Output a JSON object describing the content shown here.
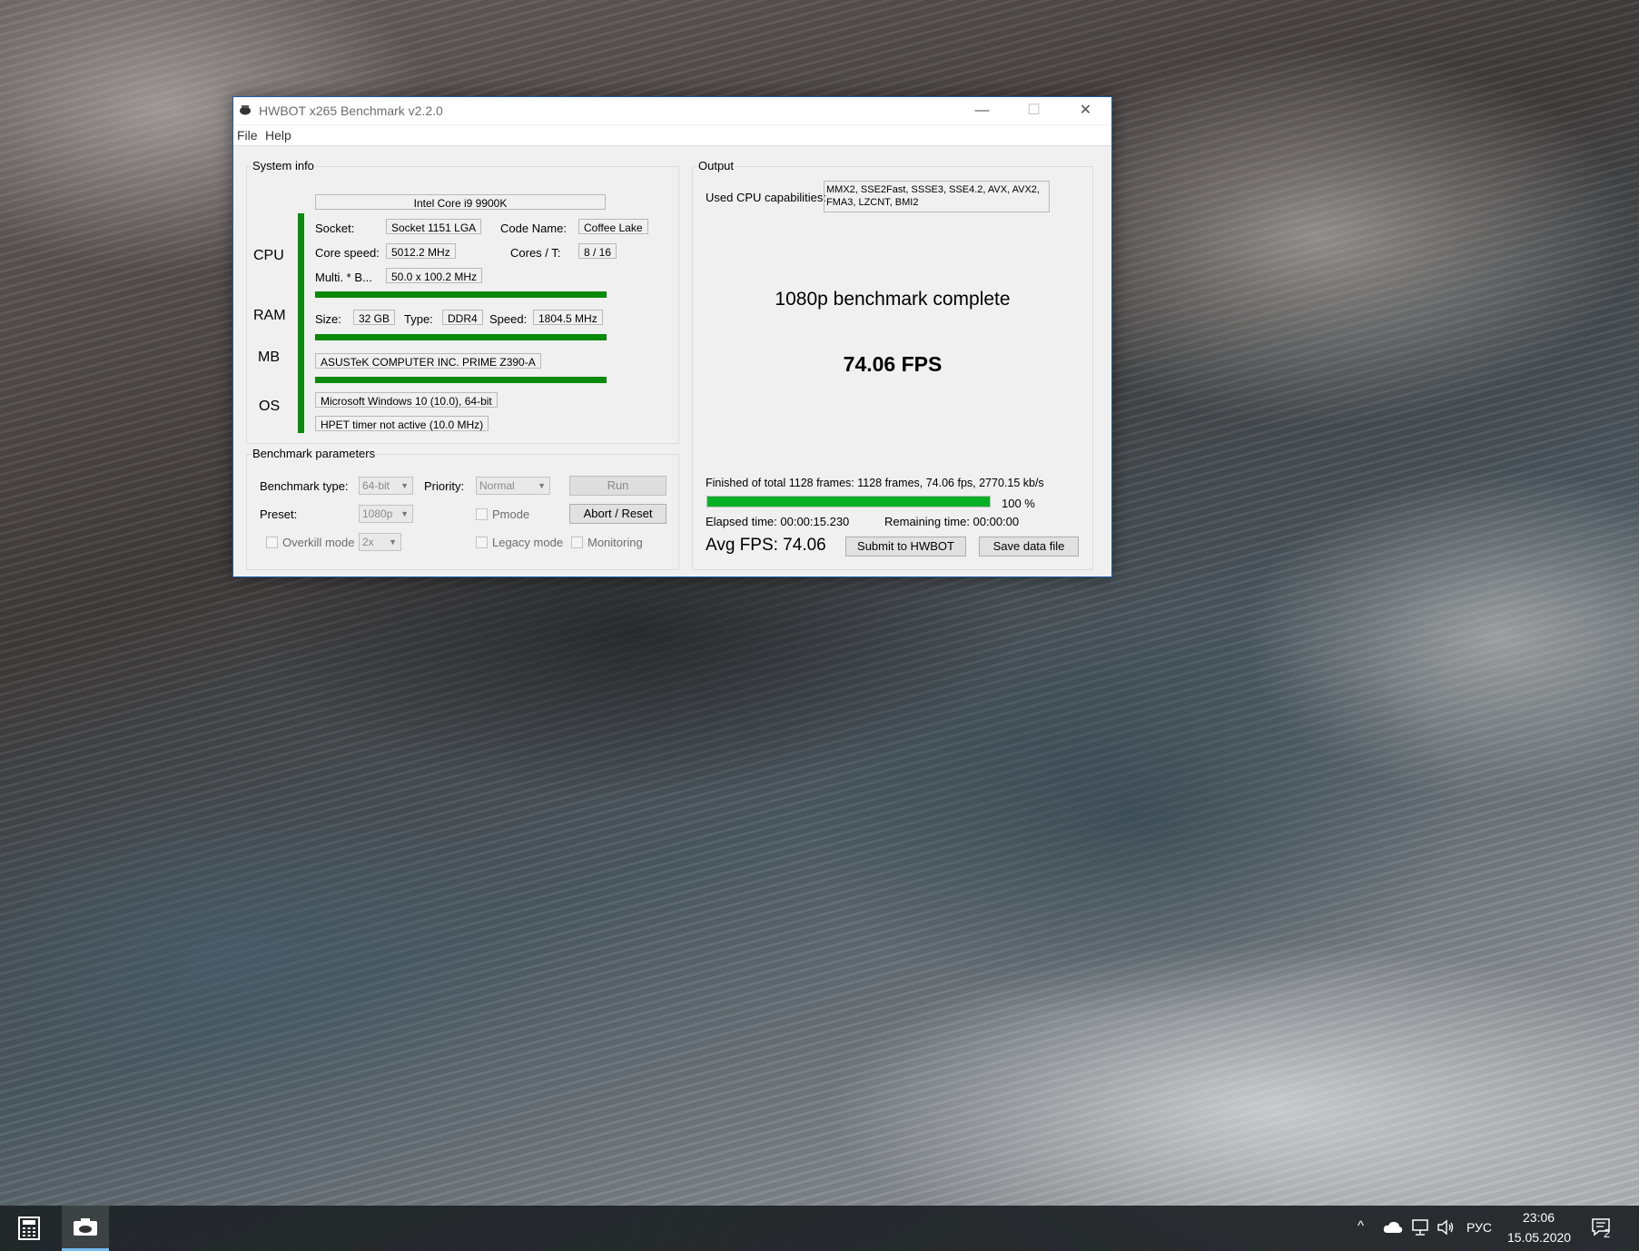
{
  "window": {
    "title": "HWBOT x265 Benchmark v2.2.0",
    "minimize": "—",
    "maximize": "☐",
    "close": "✕"
  },
  "menu": {
    "file": "File",
    "help": "Help"
  },
  "system_info": {
    "title": "System info",
    "cpu_name": "Intel Core i9 9900K",
    "categories": {
      "cpu": "CPU",
      "ram": "RAM",
      "mb": "MB",
      "os": "OS"
    },
    "socket_label": "Socket:",
    "socket": "Socket 1151 LGA",
    "code_name_label": "Code Name:",
    "code_name": "Coffee Lake",
    "core_speed_label": "Core speed:",
    "core_speed": "5012.2 MHz",
    "cores_label": "Cores / T:",
    "cores": "8 / 16",
    "multi_label": "Multi. * B...",
    "multi": "50.0 x 100.2 MHz",
    "ram_size_label": "Size:",
    "ram_size": "32 GB",
    "ram_type_label": "Type:",
    "ram_type": "DDR4",
    "ram_speed_label": "Speed:",
    "ram_speed": "1804.5 MHz",
    "mb": "ASUSTeK COMPUTER INC. PRIME Z390-A",
    "os": "Microsoft Windows 10 (10.0), 64-bit",
    "timer": "HPET timer not active (10.0 MHz)"
  },
  "benchmark_params": {
    "title": "Benchmark parameters",
    "type_label": "Benchmark type:",
    "type_value": "64-bit",
    "priority_label": "Priority:",
    "priority_value": "Normal",
    "run": "Run",
    "preset_label": "Preset:",
    "preset_value": "1080p",
    "pmode": "Pmode",
    "abort": "Abort / Reset",
    "overkill": "Overkill mode",
    "overkill_value": "2x",
    "legacy": "Legacy mode",
    "monitoring": "Monitoring"
  },
  "output": {
    "title": "Output",
    "capabilities_label": "Used CPU capabilities:",
    "capabilities_line1": "MMX2, SSE2Fast, SSSE3, SSE4.2, AVX, AVX2,",
    "capabilities_line2": "FMA3, LZCNT, BMI2",
    "status": "1080p benchmark complete",
    "fps": "74.06 FPS",
    "finished": "Finished of total 1128 frames: 1128 frames, 74.06 fps,  2770.15 kb/s",
    "progress_fraction": 1.0,
    "progress_text": "100 %",
    "elapsed": "Elapsed time: 00:00:15.230",
    "remaining": "Remaining time: 00:00:00",
    "avg_fps": "Avg FPS: 74.06",
    "submit": "Submit to HWBOT",
    "save": "Save data file"
  },
  "taskbar": {
    "tray_arrow": "^",
    "lang": "РУС",
    "time": "23:06",
    "date": "15.05.2020",
    "notifications": "2"
  },
  "colors": {
    "accent_green": "#0a8a0a",
    "progress_green": "#06b025",
    "taskbar_active": "#76b9ed"
  }
}
